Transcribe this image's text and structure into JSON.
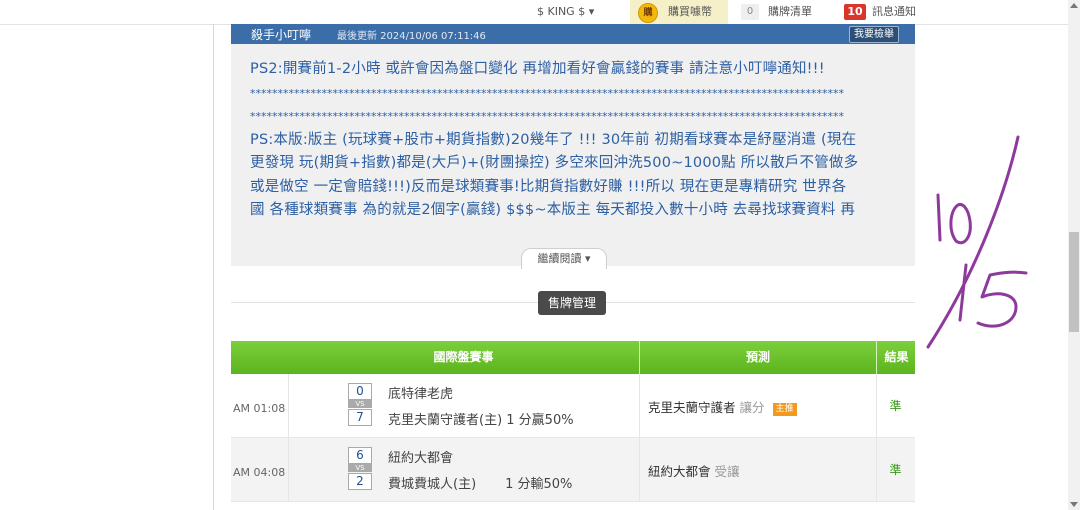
{
  "topbar": {
    "user": "$ KING $ ▾",
    "coin_badge": "購",
    "buy_coins": "購買噱幣",
    "cart_count": "0",
    "cart": "購牌清單",
    "msg_count": "10",
    "messages": "訊息通知"
  },
  "note": {
    "title": "殺手小叮嚀",
    "updated": "最後更新 2024/10/06 07:11:46",
    "report": "我要檢舉",
    "lines": [
      "PS2:開賽前1-2小時 或許會因為盤口變化 再增加看好會贏錢的賽事  請注意小叮嚀通知!!!",
      "************************************************************************************************************",
      "************************************************************************************************************",
      "PS:本版:版主 (玩球賽+股市+期貨指數)20幾年了 !!! 30年前 初期看球賽本是紓壓消遣 (現在",
      "更發現 玩(期貨+指數)都是(大戶)+(財團操控) 多空來回沖洗500~1000點 所以散戶不管做多",
      "或是做空 一定會賠錢!!!)反而是球類賽事!比期貨指數好賺 !!!所以 現在更是專精研究 世界各",
      "國 各種球類賽事 為的就是2個字(贏錢) $$$~本版主 每天都投入數十小時 去尋找球賽資料 再"
    ],
    "read_more": "繼續閱讀 ▾"
  },
  "sell_manage": "售牌管理",
  "table": {
    "headers": {
      "match": "國際盤賽事",
      "prediction": "預測",
      "result": "結果"
    },
    "vs_label": "VS",
    "rows": [
      {
        "time": "AM 01:08",
        "score_away": "0",
        "score_home": "7",
        "team_away": "底特律老虎",
        "team_home": "克里夫蘭守護者(主) 1 分贏50%",
        "pred_team": "克里夫蘭守護者",
        "pred_type": "讓分",
        "pred_badge": "主推",
        "result": "準"
      },
      {
        "time": "AM 04:08",
        "score_away": "6",
        "score_home": "2",
        "team_away": "紐約大都會",
        "team_home": "費城費城人(主)       1 分輸50%",
        "pred_team": "紐約大都會",
        "pred_type": "受讓",
        "pred_badge": "",
        "result": "準"
      }
    ]
  },
  "annotation": {
    "text": "10/15",
    "color": "#8e3a9c"
  },
  "colors": {
    "header_green": "#5cb41e",
    "note_blue": "#2d5fa3",
    "bar_blue": "#3b6ea8",
    "result_green": "#3a9a1c",
    "msg_red": "#d9352b"
  }
}
